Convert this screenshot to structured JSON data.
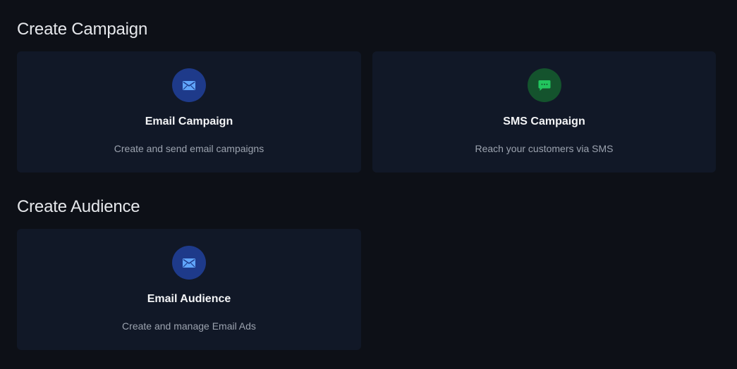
{
  "sections": {
    "campaign": {
      "title": "Create Campaign",
      "cards": [
        {
          "title": "Email Campaign",
          "description": "Create and send email campaigns",
          "icon": "mail-icon",
          "icon_bg": "#1e3a8a",
          "icon_color": "#60a5fa"
        },
        {
          "title": "SMS Campaign",
          "description": "Reach your customers via SMS",
          "icon": "chat-bubble-icon",
          "icon_bg": "#14532d",
          "icon_color": "#22c55e"
        }
      ]
    },
    "audience": {
      "title": "Create Audience",
      "cards": [
        {
          "title": "Email Audience",
          "description": "Create and manage Email Ads",
          "icon": "mail-icon",
          "icon_bg": "#1e3a8a",
          "icon_color": "#60a5fa"
        }
      ]
    }
  },
  "colors": {
    "background": "#0d1017",
    "card_background": "#111827"
  }
}
